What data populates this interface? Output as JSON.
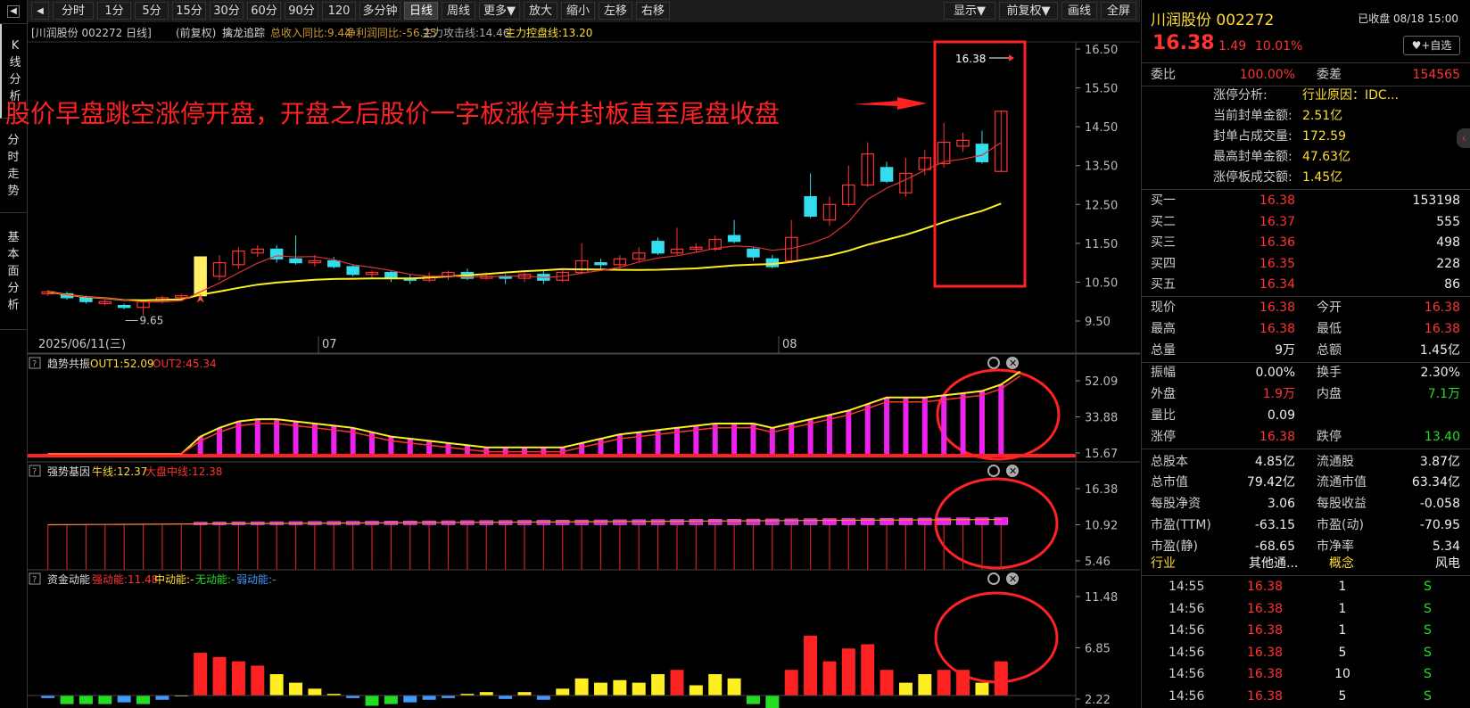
{
  "sidebar": {
    "tabs": [
      "K线分析",
      "分时走势",
      "基本面分析"
    ]
  },
  "toolbar": {
    "buttons": [
      "分时",
      "1分",
      "5分",
      "15分",
      "30分",
      "60分",
      "90分",
      "120分",
      "多分钟",
      "日线",
      "周线",
      "更多▼",
      "放大",
      "缩小",
      "左移",
      "右移"
    ],
    "right_buttons": [
      "显示▼",
      "前复权▼",
      "画线",
      "全屏"
    ],
    "active": "日线"
  },
  "main_chart": {
    "header": {
      "stock": "[川润股份 002272 日线]",
      "adj": "(前复权)",
      "indicator": "擒龙追踪",
      "rev": "总收入同比:9.44",
      "profit": "净利润同比:-56.25",
      "attack": "主力攻击线:14.46",
      "control": "主力控盘线:13.20"
    },
    "price_ticks": [
      "16.50",
      "15.50",
      "14.50",
      "13.50",
      "12.50",
      "11.50",
      "10.50",
      "9.50"
    ],
    "date_labels": [
      "2025/06/11(三)",
      "07",
      "08"
    ],
    "low_label": "9.65",
    "high_label": "16.38",
    "annotation": "股价早盘跳空涨停开盘，开盘之后股价一字板涨停并封板直至尾盘收盘"
  },
  "ind1": {
    "name": "趋势共振",
    "out1": "OUT1:52.09",
    "out2": "OUT2:45.34",
    "ticks": [
      "52.09",
      "33.88",
      "15.67"
    ]
  },
  "ind2": {
    "name": "强势基因",
    "bull": "牛线:12.37",
    "market": "大盘中线:12.38",
    "ticks": [
      "16.38",
      "10.92",
      "5.46"
    ]
  },
  "ind3": {
    "name": "资金动能",
    "strong": "强动能:11.48",
    "mid": "中动能:-",
    "none": "无动能:-",
    "weak": "弱动能:-",
    "ticks": [
      "11.48",
      "6.85",
      "2.22"
    ]
  },
  "quote": {
    "title": "川润股份 002272",
    "status": "已收盘 08/18 15:00",
    "price": "16.38",
    "change": "1.49",
    "pct": "10.01%",
    "fav": "+自选",
    "weibi_label": "委比",
    "weibi": "100.00%",
    "weicha_label": "委差",
    "weicha": "154565",
    "limit_info": [
      {
        "label": "涨停分析:",
        "value": "行业原因：IDC..."
      },
      {
        "label": "当前封单金额:",
        "value": "2.51亿"
      },
      {
        "label": "封单占成交量:",
        "value": "172.59"
      },
      {
        "label": "最高封单金额:",
        "value": "47.63亿"
      },
      {
        "label": "涨停板成交额:",
        "value": "1.45亿"
      }
    ],
    "bids": [
      {
        "label": "买一",
        "price": "16.38",
        "vol": "153198"
      },
      {
        "label": "买二",
        "price": "16.37",
        "vol": "555"
      },
      {
        "label": "买三",
        "price": "16.36",
        "vol": "498"
      },
      {
        "label": "买四",
        "price": "16.35",
        "vol": "228"
      },
      {
        "label": "买五",
        "price": "16.34",
        "vol": "86"
      }
    ],
    "stats": [
      [
        {
          "l": "现价",
          "v": "16.38",
          "c": "red"
        },
        {
          "l": "今开",
          "v": "16.38",
          "c": "red"
        }
      ],
      [
        {
          "l": "最高",
          "v": "16.38",
          "c": "red"
        },
        {
          "l": "最低",
          "v": "16.38",
          "c": "red"
        }
      ],
      [
        {
          "l": "总量",
          "v": "9万",
          "c": "white"
        },
        {
          "l": "总额",
          "v": "1.45亿",
          "c": "white"
        }
      ],
      [
        {
          "l": "振幅",
          "v": "0.00%",
          "c": "white"
        },
        {
          "l": "换手",
          "v": "2.30%",
          "c": "white"
        }
      ],
      [
        {
          "l": "外盘",
          "v": "1.9万",
          "c": "red"
        },
        {
          "l": "内盘",
          "v": "7.1万",
          "c": "green"
        }
      ],
      [
        {
          "l": "量比",
          "v": "0.09",
          "c": "white"
        },
        {
          "l": "",
          "v": "",
          "c": "white"
        }
      ],
      [
        {
          "l": "涨停",
          "v": "16.38",
          "c": "red"
        },
        {
          "l": "跌停",
          "v": "13.40",
          "c": "green"
        }
      ],
      [
        {
          "l": "总股本",
          "v": "4.85亿",
          "c": "white"
        },
        {
          "l": "流通股",
          "v": "3.87亿",
          "c": "white"
        }
      ],
      [
        {
          "l": "总市值",
          "v": "79.42亿",
          "c": "white"
        },
        {
          "l": "流通市值",
          "v": "63.34亿",
          "c": "white"
        }
      ],
      [
        {
          "l": "每股净资",
          "v": "3.06",
          "c": "white"
        },
        {
          "l": "每股收益",
          "v": "-0.058",
          "c": "white"
        }
      ],
      [
        {
          "l": "市盈(TTM)",
          "v": "-63.15",
          "c": "white"
        },
        {
          "l": "市盈(动)",
          "v": "-70.95",
          "c": "white"
        }
      ],
      [
        {
          "l": "市盈(静)",
          "v": "-68.65",
          "c": "white"
        },
        {
          "l": "市净率",
          "v": "5.34",
          "c": "white"
        }
      ]
    ],
    "industry": {
      "l1": "行业",
      "v1": "其他通...",
      "l2": "概念",
      "v2": "风电"
    },
    "trades": [
      {
        "t": "14:55",
        "p": "16.38",
        "v": "1",
        "s": "S"
      },
      {
        "t": "14:56",
        "p": "16.38",
        "v": "1",
        "s": "S"
      },
      {
        "t": "14:56",
        "p": "16.38",
        "v": "1",
        "s": "S"
      },
      {
        "t": "14:56",
        "p": "16.38",
        "v": "5",
        "s": "S"
      },
      {
        "t": "14:56",
        "p": "16.38",
        "v": "10",
        "s": "S"
      },
      {
        "t": "14:56",
        "p": "16.38",
        "v": "5",
        "s": "S"
      }
    ]
  },
  "chart_data": {
    "type": "candlestick",
    "ylim": [
      9.5,
      16.5
    ],
    "candles": [
      [
        10.2,
        10.25,
        10.3,
        10.15
      ],
      [
        10.2,
        10.1,
        10.25,
        10.05
      ],
      [
        10.1,
        10.0,
        10.15,
        9.95
      ],
      [
        9.95,
        10.0,
        10.05,
        9.9
      ],
      [
        9.9,
        9.85,
        9.95,
        9.8
      ],
      [
        9.85,
        10.0,
        10.05,
        9.65
      ],
      [
        10.0,
        10.1,
        10.15,
        9.95
      ],
      [
        10.1,
        10.15,
        10.2,
        10.05
      ],
      [
        10.15,
        11.15,
        11.15,
        10.25
      ],
      [
        10.65,
        11.0,
        11.2,
        10.55
      ],
      [
        10.95,
        11.3,
        11.4,
        10.85
      ],
      [
        11.25,
        11.35,
        11.45,
        11.15
      ],
      [
        11.35,
        11.1,
        11.45,
        11.0
      ],
      [
        11.1,
        11.0,
        11.7,
        10.95
      ],
      [
        11.0,
        11.05,
        11.2,
        10.9
      ],
      [
        11.05,
        10.9,
        11.15,
        10.85
      ],
      [
        10.9,
        10.7,
        10.95,
        10.65
      ],
      [
        10.7,
        10.75,
        10.8,
        10.6
      ],
      [
        10.75,
        10.6,
        10.8,
        10.5
      ],
      [
        10.6,
        10.55,
        10.7,
        10.45
      ],
      [
        10.55,
        10.65,
        10.75,
        10.5
      ],
      [
        10.65,
        10.75,
        10.8,
        10.55
      ],
      [
        10.75,
        10.6,
        10.85,
        10.55
      ],
      [
        10.6,
        10.65,
        10.75,
        10.55
      ],
      [
        10.65,
        10.6,
        10.7,
        10.45
      ],
      [
        10.6,
        10.7,
        10.75,
        10.5
      ],
      [
        10.7,
        10.55,
        10.8,
        10.45
      ],
      [
        10.55,
        10.75,
        10.85,
        10.5
      ],
      [
        10.75,
        11.05,
        11.5,
        10.7
      ],
      [
        11.0,
        10.95,
        11.1,
        10.85
      ],
      [
        10.95,
        11.1,
        11.2,
        10.85
      ],
      [
        11.1,
        11.25,
        11.4,
        11.0
      ],
      [
        11.55,
        11.25,
        11.65,
        11.2
      ],
      [
        11.25,
        11.35,
        11.9,
        11.2
      ],
      [
        11.35,
        11.4,
        11.5,
        11.25
      ],
      [
        11.35,
        11.6,
        11.7,
        11.3
      ],
      [
        11.7,
        11.55,
        12.1,
        11.5
      ],
      [
        11.35,
        11.15,
        11.4,
        11.05
      ],
      [
        11.1,
        10.9,
        11.2,
        10.85
      ],
      [
        11.05,
        11.65,
        12.1,
        11.0
      ],
      [
        12.7,
        12.2,
        13.3,
        12.15
      ],
      [
        12.1,
        12.5,
        12.7,
        11.95
      ],
      [
        12.5,
        13.0,
        13.5,
        12.45
      ],
      [
        13.0,
        13.8,
        14.1,
        12.95
      ],
      [
        13.45,
        13.1,
        13.6,
        13.05
      ],
      [
        12.8,
        13.3,
        13.7,
        12.7
      ],
      [
        13.4,
        13.7,
        13.9,
        13.25
      ],
      [
        13.55,
        14.1,
        14.6,
        13.45
      ],
      [
        14.0,
        14.15,
        14.35,
        13.85
      ],
      [
        14.05,
        13.6,
        14.4,
        13.55
      ],
      [
        13.35,
        14.9,
        14.9,
        13.35
      ]
    ]
  }
}
